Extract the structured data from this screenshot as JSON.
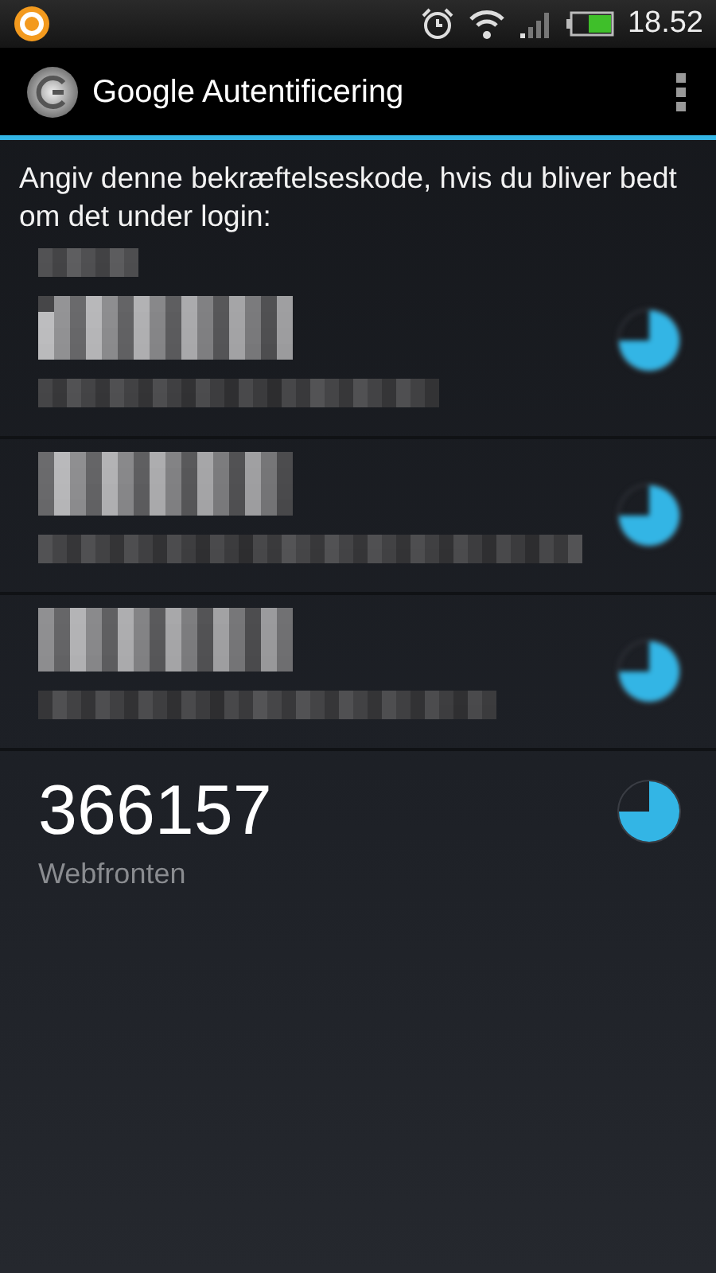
{
  "status_bar": {
    "time": "18.52"
  },
  "action_bar": {
    "title": "Google Autentificering"
  },
  "instruction": "Angiv denne bekræftelseskode, hvis du bliver bedt om det under login:",
  "accounts": [
    {
      "kind": "redacted_with_issuer"
    },
    {
      "kind": "redacted"
    },
    {
      "kind": "redacted"
    },
    {
      "kind": "code",
      "code": "366157",
      "name": "Webfronten"
    }
  ]
}
